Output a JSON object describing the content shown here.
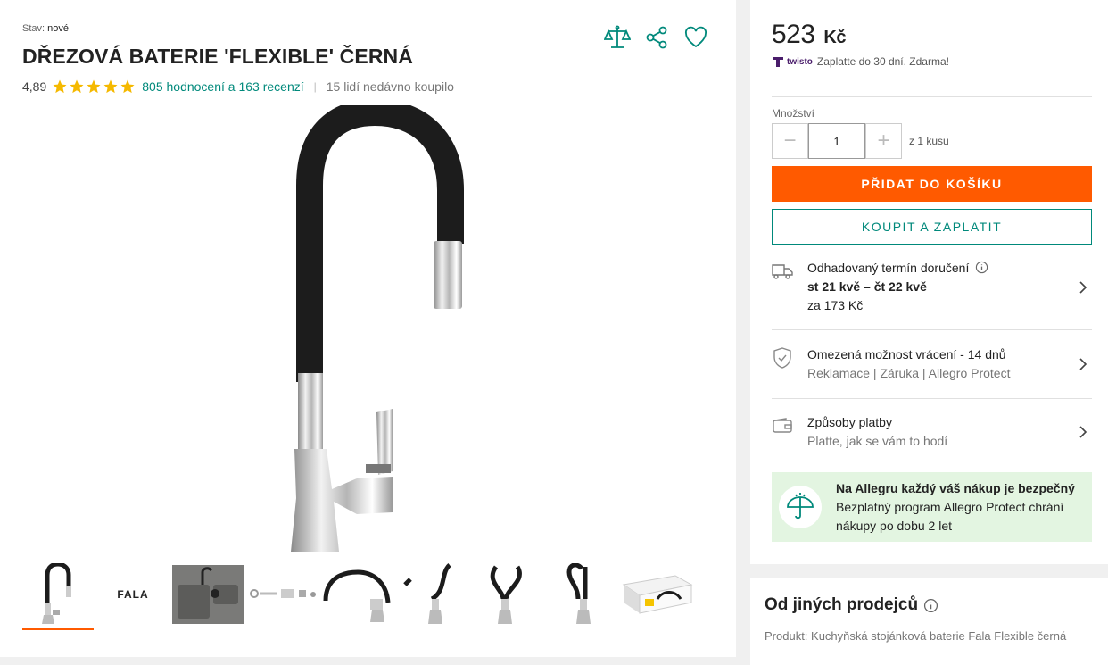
{
  "product": {
    "condition_label": "Stav:",
    "condition_value": "nové",
    "title": "DŘEZOVÁ BATERIE 'FLEXIBLE' ČERNÁ",
    "rating_value": "4,89",
    "rating_stars": 5,
    "reviews_link": "805 hodnocení a 163 recenzí",
    "separator": "|",
    "recently_bought": "15 lidí nedávno koupilo"
  },
  "top_icons": [
    "compare-icon",
    "share-icon",
    "heart-icon"
  ],
  "thumbnails": [
    {
      "name": "thumb-faucet-front",
      "active": true
    },
    {
      "name": "thumb-fala-logo",
      "text": "FALA"
    },
    {
      "name": "thumb-sink"
    },
    {
      "name": "thumb-parts"
    },
    {
      "name": "thumb-faucet-bent"
    },
    {
      "name": "thumb-faucet-side"
    },
    {
      "name": "thumb-faucet-loop"
    },
    {
      "name": "thumb-faucet-curl"
    },
    {
      "name": "thumb-box"
    },
    {
      "name": "thumb-faucet-partial"
    }
  ],
  "buy_box": {
    "price": "523",
    "currency": "Kč",
    "twisto_brand": "twisto",
    "twisto_text": "Zaplatte do 30 dní. Zdarma!",
    "qty_label": "Množství",
    "qty_minus": "−",
    "qty_plus": "+",
    "qty_value": "1",
    "qty_of": "z 1 kusu",
    "add_to_cart": "PŘIDAT DO KOŠÍKU",
    "buy_now": "KOUPIT A ZAPLATIT"
  },
  "delivery": {
    "label": "Odhadovaný termín doručení",
    "dates": "st 21 kvě – čt 22 kvě",
    "price": "za 173 Kč"
  },
  "returns": {
    "label": "Omezená možnost vrácení - 14 dnů",
    "links": "Reklamace | Záruka | Allegro Protect"
  },
  "payment": {
    "label": "Způsoby platby",
    "sub": "Platte, jak se vám to hodí"
  },
  "protect": {
    "title": "Na Allegru každý váš nákup je bezpečný",
    "text": "Bezplatný program Allegro Protect chrání nákupy po dobu 2 let"
  },
  "other_sellers": {
    "title": "Od jiných prodejců",
    "product": "Produkt: Kuchyňská stojánková baterie Fala Flexible černá"
  },
  "colors": {
    "accent_orange": "#ff5a00",
    "teal": "#00897b",
    "star": "#f5b900",
    "protect_bg": "#e3f5e1"
  }
}
